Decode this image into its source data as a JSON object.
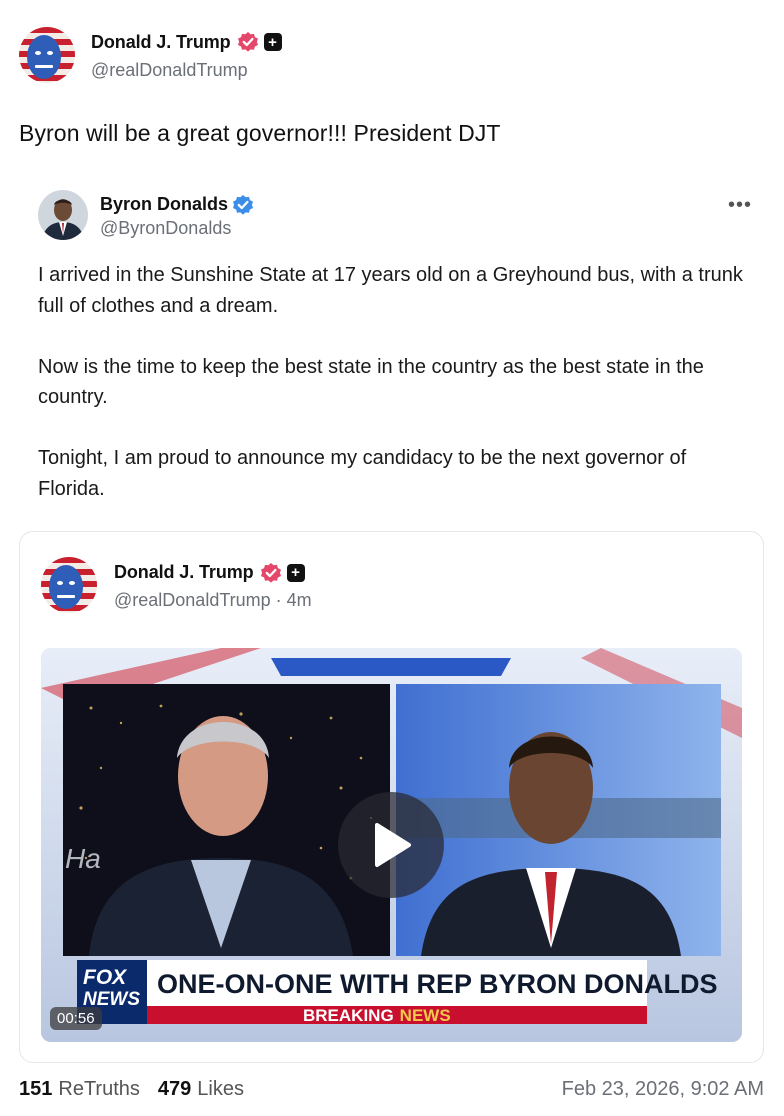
{
  "post": {
    "author_name": "Donald J. Trump",
    "author_handle": "@realDonaldTrump",
    "text": "Byron will be a great governor!!! President DJT"
  },
  "quoted": {
    "author_name": "Byron Donalds",
    "author_handle": "@ByronDonalds",
    "paragraphs": [
      "I arrived in the Sunshine State at 17 years old on a Greyhound bus, with a trunk full of clothes and a dream.",
      "Now is the time to keep the best state in the country as the best state in the country.",
      "Tonight, I am proud to announce my candidacy to be the next governor of Florida."
    ],
    "more_label": "•••"
  },
  "embedded": {
    "author_name": "Donald J. Trump",
    "author_handle": "@realDonaldTrump · 4m",
    "video": {
      "chyron": "ONE-ON-ONE WITH REP BYRON DONALDS",
      "banner": "BREAKING",
      "banner_accent": "NEWS",
      "network_top": "FOX",
      "network_bottom": "NEWS",
      "bug_text": "Ha",
      "duration": "00:56"
    }
  },
  "stats": {
    "retruths_count": "151",
    "retruths_label": "ReTruths",
    "likes_count": "479",
    "likes_label": "Likes",
    "timestamp": "Feb 23, 2026, 9:02 AM"
  },
  "colors": {
    "verified_pink": "#e5476b",
    "verified_blue": "#3b8ee8",
    "text_muted": "#6b6f76",
    "fox_red": "#c8102e"
  },
  "icons": {
    "verified_author": "verified-badge-pink-icon",
    "plus": "plus-badge-icon",
    "verified_quoted": "verified-badge-blue-icon",
    "play": "play-icon",
    "more": "more-dots-icon"
  }
}
